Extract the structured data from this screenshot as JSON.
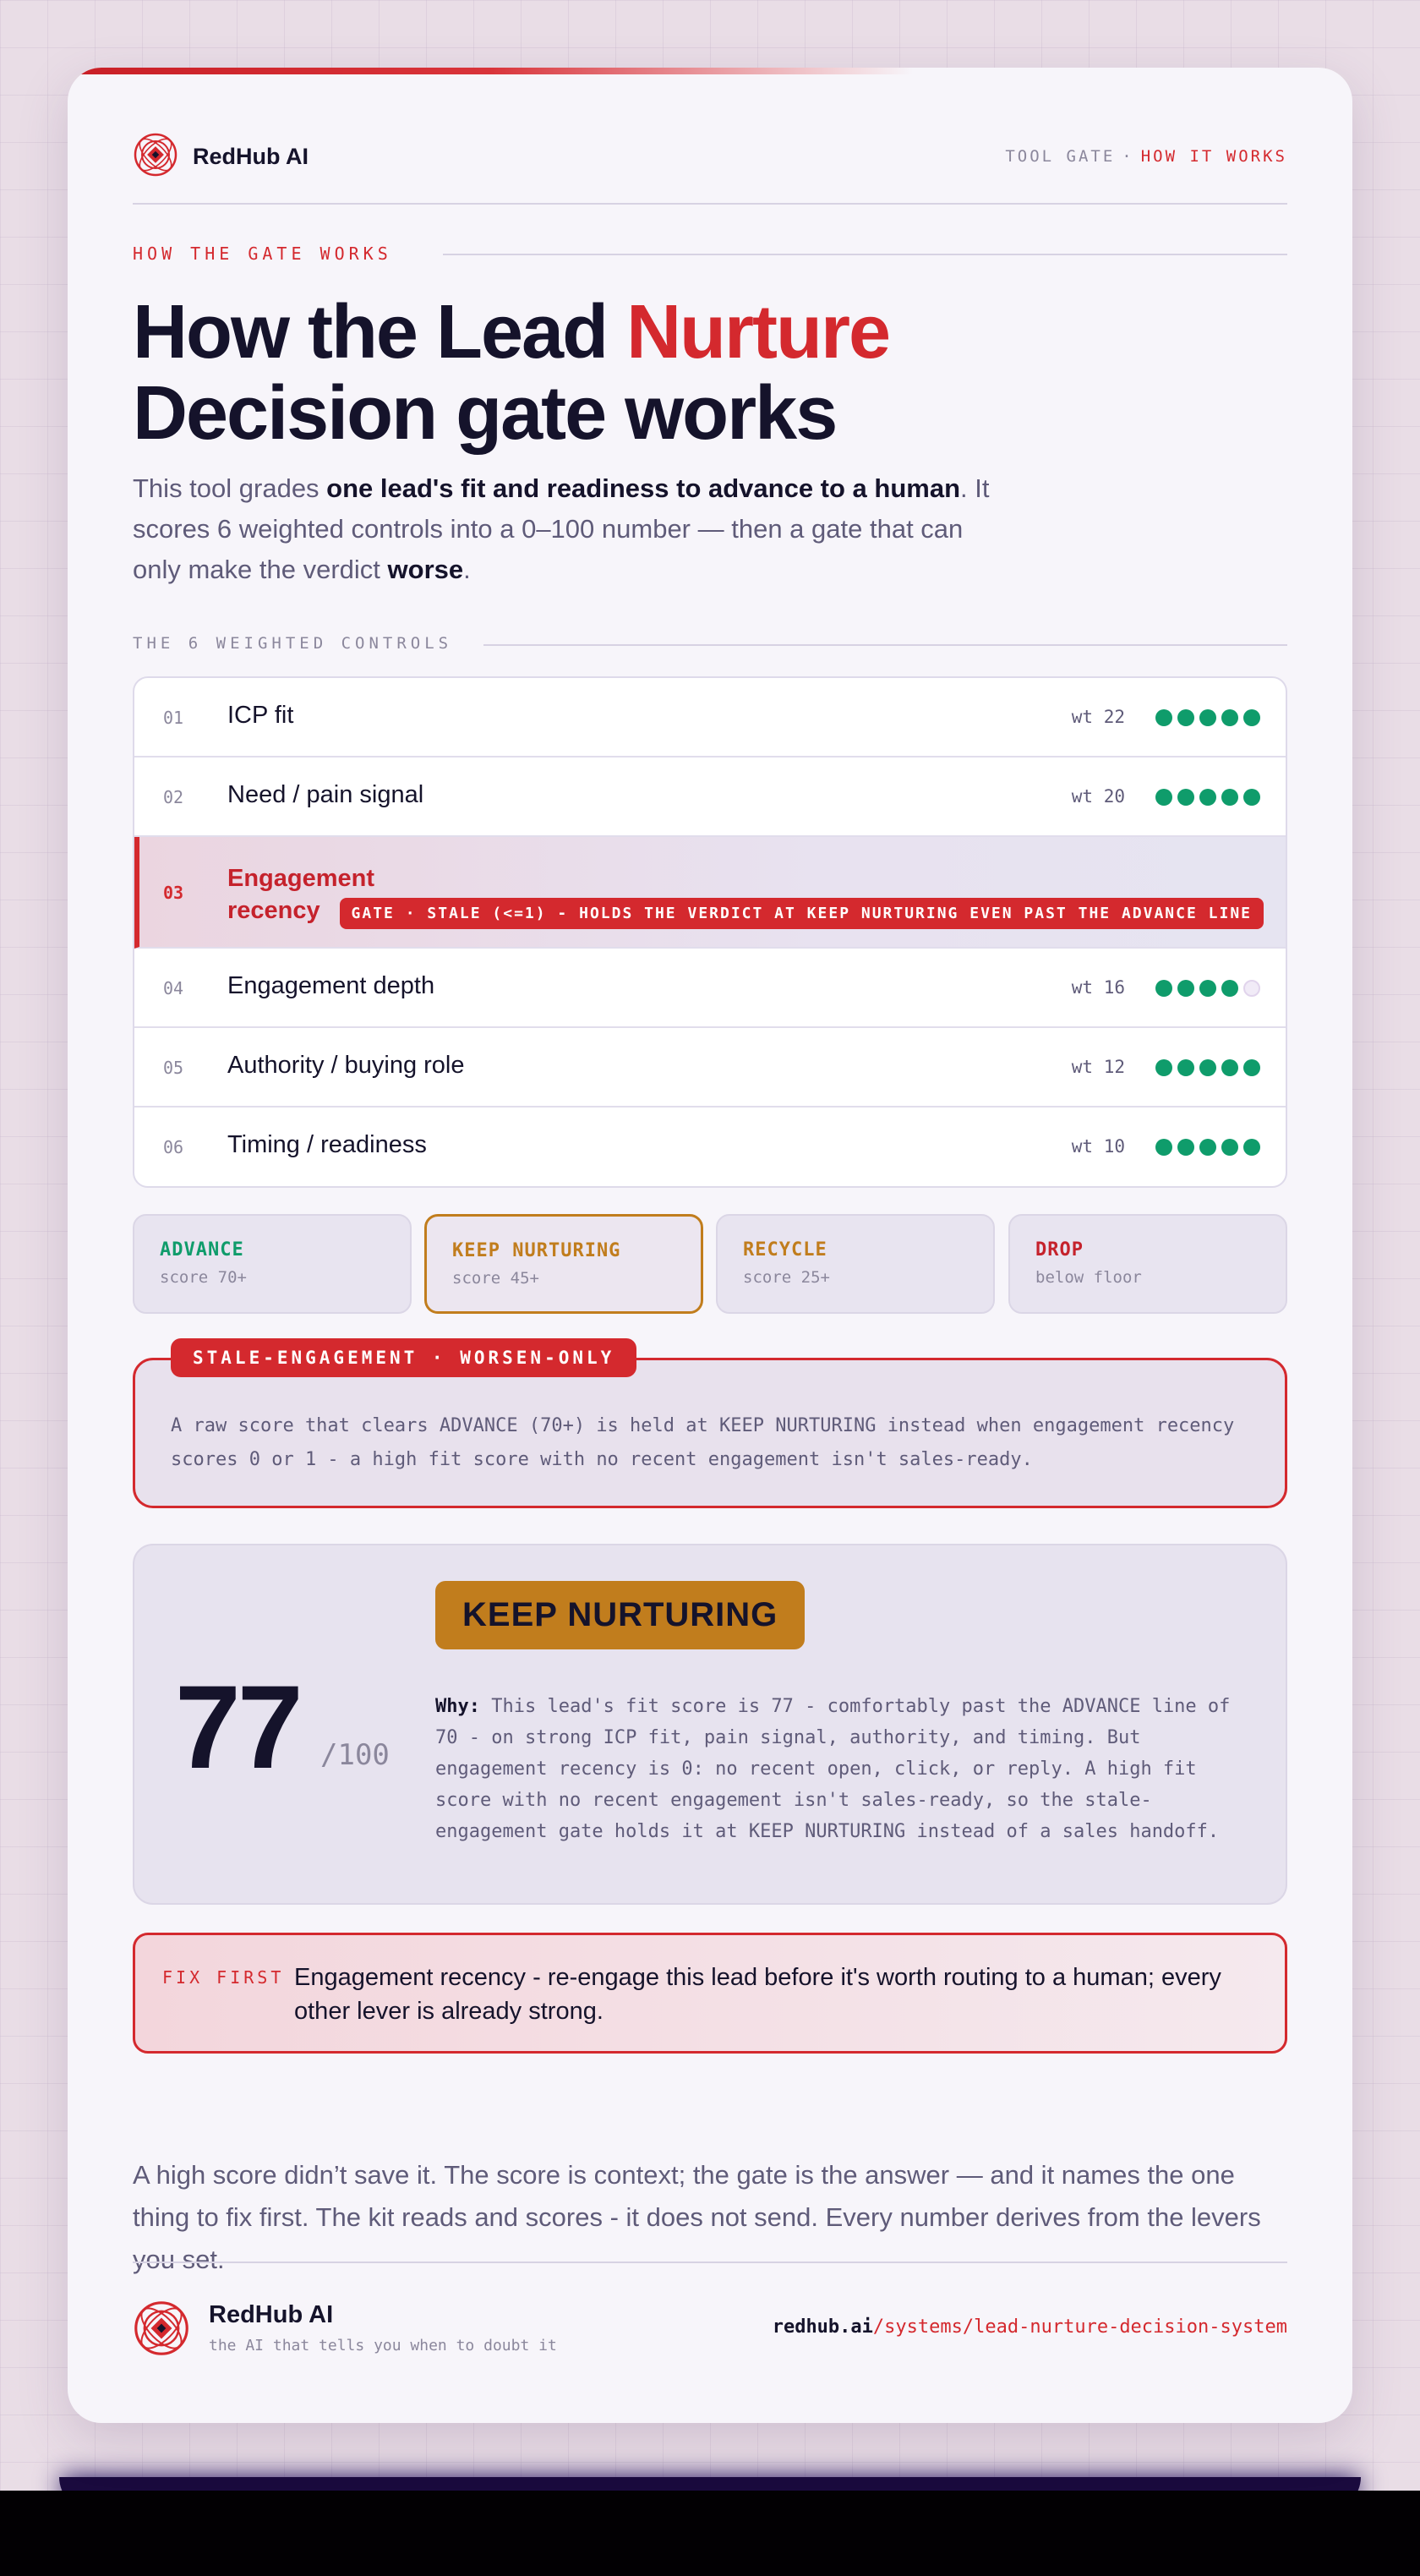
{
  "brand": {
    "name": "RedHub AI",
    "tagline": "the AI that tells you when to doubt it"
  },
  "breadcrumb": {
    "section": "TOOL GATE",
    "separator": "·",
    "current": "HOW IT WORKS"
  },
  "eyebrow": "HOW THE GATE WORKS",
  "title": {
    "line1_a": "How the Lead ",
    "line1_red": "Nurture",
    "line2": "Decision gate works"
  },
  "lede": {
    "p1": "This tool grades ",
    "b1": "one lead's fit and readiness to advance to a human",
    "p2": ". It scores 6 weighted controls into a 0–100 number — then a gate that can only make the verdict ",
    "b2": "worse",
    "p3": "."
  },
  "controls_label": "THE 6 WEIGHTED CONTROLS",
  "controls": [
    {
      "num": "01",
      "name": "ICP fit",
      "wt": "wt 22",
      "filled": 5
    },
    {
      "num": "02",
      "name": "Need / pain signal",
      "wt": "wt 20",
      "filled": 5
    },
    {
      "num": "03",
      "name_l1": "Engagement",
      "name_l2": "recency",
      "gate": "GATE · STALE (<=1) - HOLDS THE VERDICT AT KEEP NURTURING EVEN PAST THE ADVANCE LINE"
    },
    {
      "num": "04",
      "name": "Engagement depth",
      "wt": "wt 16",
      "filled": 4
    },
    {
      "num": "05",
      "name": "Authority / buying role",
      "wt": "wt 12",
      "filled": 5
    },
    {
      "num": "06",
      "name": "Timing / readiness",
      "wt": "wt 10",
      "filled": 5
    }
  ],
  "verdicts": [
    {
      "label": "ADVANCE",
      "sub": "score 70+",
      "color": "#0f9c6b"
    },
    {
      "label": "KEEP NURTURING",
      "sub": "score 45+",
      "color": "#c17d1d",
      "selected": true
    },
    {
      "label": "RECYCLE",
      "sub": "score 25+",
      "color": "#c17d1d"
    },
    {
      "label": "DROP",
      "sub": "below floor",
      "color": "#c5222c"
    }
  ],
  "stale": {
    "tag": "STALE-ENGAGEMENT · WORSEN-ONLY",
    "text": "A raw score that clears ADVANCE (70+) is held at KEEP NURTURING instead when engagement recency scores 0 or 1 - a high fit score with no recent engagement isn't sales-ready."
  },
  "result": {
    "score": "77",
    "denominator": "/100",
    "verdict": "KEEP NURTURING",
    "why_label": "Why:",
    "why_text": "This lead's fit score is 77 - comfortably past the ADVANCE line of 70 - on strong ICP fit, pain signal, authority, and timing. But engagement recency is 0: no recent open, click, or reply. A high fit score with no recent engagement isn't sales-ready, so the stale-engagement gate holds it at KEEP NURTURING instead of a sales handoff."
  },
  "fix": {
    "tag": "FIX FIRST",
    "text": "Engagement recency - re-engage this lead before it's worth routing to a human; every other lever is already strong."
  },
  "closing": "A high score didn’t save it. The score is context; the gate is the answer — and it names the one thing to fix first. The kit reads and scores - it does not send. Every number derives from the levers you set.",
  "footer": {
    "url_domain": "redhub.ai",
    "url_path": "/systems/lead-nurture-decision-system"
  },
  "colors": {
    "accent": "#d4292e",
    "ink": "#15132b",
    "green": "#0f9c6b",
    "amber": "#c17d1d"
  }
}
